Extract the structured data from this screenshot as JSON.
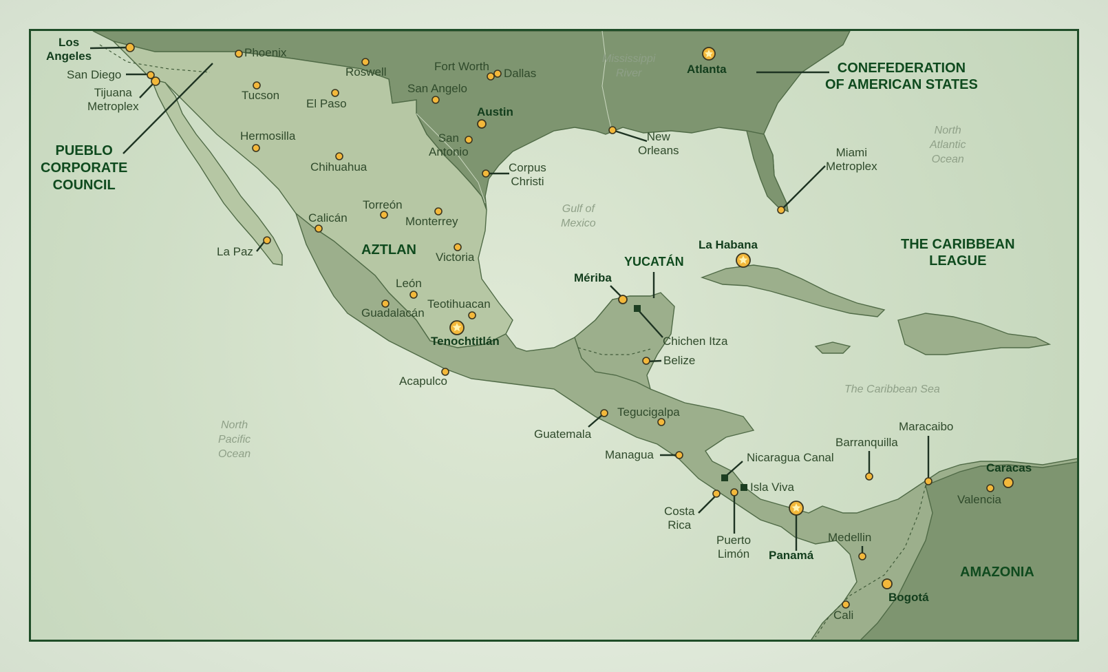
{
  "regions": {
    "pcc": "PUEBLO\nCORPORATE\nCOUNCIL",
    "aztlan": "AZTLAN",
    "cas": "CONEFEDERATION\nOF AMERICAN STATES",
    "caribbean": "THE CARIBBEAN\nLEAGUE",
    "yucatan": "YUCATÁN",
    "amazonia": "AMAZONIA"
  },
  "waters": {
    "north_pacific": "North\nPacific\nOcean",
    "north_atlantic": "North\nAtlantic\nOcean",
    "gulf": "Gulf of\nMexico",
    "caribbean_sea": "The Caribbean Sea",
    "mississippi": "Mississippi\nRiver"
  },
  "cities": {
    "los_angeles": "Los\nAngeles",
    "san_diego": "San Diego",
    "tijuana": "Tijuana\nMetroplex",
    "phoenix": "Phoenix",
    "tucson": "Tucson",
    "roswell": "Roswell",
    "el_paso": "El Paso",
    "hermosilla": "Hermosilla",
    "chihuahua": "Chihuahua",
    "fort_worth": "Fort Worth",
    "dallas": "Dallas",
    "san_angelo": "San Angelo",
    "austin": "Austin",
    "san_antonio": "San\nAntonio",
    "corpus_christi": "Corpus\nChristi",
    "atlanta": "Atlanta",
    "new_orleans": "New\nOrleans",
    "miami": "Miami\nMetroplex",
    "torreon": "Torreón",
    "calican": "Calicán",
    "monterrey": "Monterrey",
    "la_paz": "La Paz",
    "victoria": "Victoria",
    "leon": "León",
    "guadalacan": "Guadalacán",
    "teotihuacan": "Teotihuacan",
    "tenochtitlan": "Tenochtitlán",
    "acapulco": "Acapulco",
    "meriba": "Mériba",
    "chichen_itza": "Chichen Itza",
    "belize": "Belize",
    "la_habana": "La Habana",
    "tegucigalpa": "Tegucigalpa",
    "guatemala": "Guatemala",
    "managua": "Managua",
    "nicaragua_canal": "Nicaragua Canal",
    "isla_viva": "Isla Viva",
    "costa_rica": "Costa\nRica",
    "puerto_limon": "Puerto\nLimón",
    "panama": "Panamá",
    "barranquilla": "Barranquilla",
    "maracaibo": "Maracaibo",
    "caracas": "Caracas",
    "valencia": "Valencia",
    "medellin": "Medellin",
    "bogota": "Bogotá",
    "cali": "Cali"
  },
  "colors": {
    "frame": "#1f4d28",
    "land": "#9caf8c",
    "city_marker": "#f3b83b",
    "label_bold": "#123d1c"
  }
}
